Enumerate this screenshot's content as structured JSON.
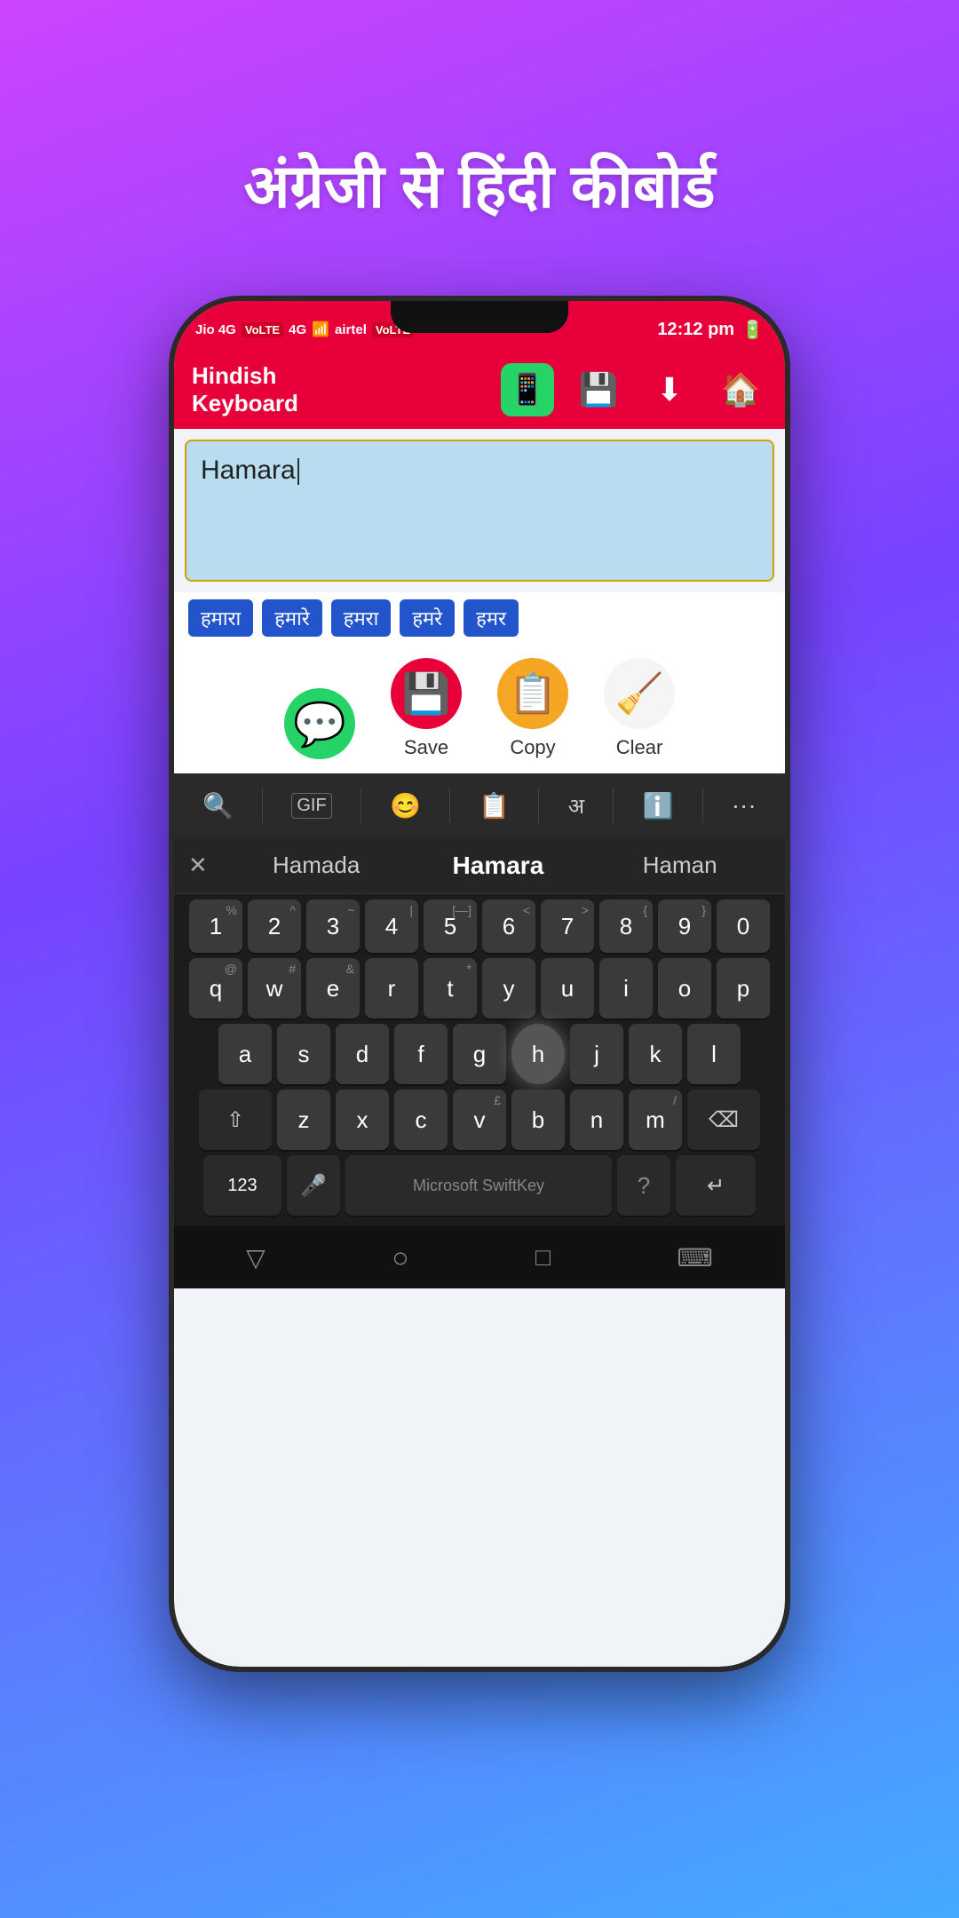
{
  "background": {
    "gradient_start": "#cc44ff",
    "gradient_end": "#44aaff"
  },
  "header": {
    "title": "अंग्रेजी से हिंदी कीबोर्ड"
  },
  "status_bar": {
    "carrier1": "Jio 4G",
    "carrier1_badge": "VoLTE",
    "carrier2": "4G",
    "carrier3": "airtel",
    "carrier3_badge": "VoLTE",
    "time": "12:12 pm",
    "battery": "🔋"
  },
  "app_header": {
    "title_line1": "Hindish",
    "title_line2": "Keyboard",
    "icons": [
      "whatsapp",
      "save",
      "download",
      "home"
    ]
  },
  "text_area": {
    "content": "Hamara",
    "placeholder": ""
  },
  "suggestions": [
    "हमारा",
    "हमारे",
    "हमरा",
    "हमरे",
    "हमर"
  ],
  "actions": [
    {
      "label": "Save",
      "icon": "💾",
      "bg": "red"
    },
    {
      "label": "Copy",
      "icon": "📋",
      "bg": "orange"
    },
    {
      "label": "Clear",
      "icon": "🧹",
      "bg": "white"
    }
  ],
  "keyboard": {
    "toolbar_icons": [
      "🔍",
      "GIF",
      "😊",
      "📋",
      "अ",
      "ℹ",
      "···"
    ],
    "autocomplete": [
      "Hamada",
      "Hamara",
      "Haman"
    ],
    "rows": {
      "numbers": [
        "1",
        "2",
        "3",
        "4",
        "5",
        "6",
        "7",
        "8",
        "9",
        "0"
      ],
      "number_subs": [
        "%",
        "^",
        "~",
        "|",
        "[—]",
        "<",
        ">",
        "{",
        "}",
        ""
      ],
      "row_q": [
        "q",
        "w",
        "e",
        "r",
        "t",
        "y",
        "u",
        "i",
        "o",
        "p"
      ],
      "row_q_subs": [
        "@",
        "#",
        "&",
        "",
        "*",
        "",
        "",
        "",
        "",
        ""
      ],
      "row_a": [
        "a",
        "s",
        "d",
        "f",
        "g",
        "h",
        "j",
        "k",
        "l"
      ],
      "row_a_subs": [
        "",
        "",
        "",
        "",
        "",
        "",
        "",
        "",
        ""
      ],
      "row_z": [
        "z",
        "x",
        "c",
        "v",
        "b",
        "n",
        "m"
      ],
      "row_z_subs": [
        "",
        "",
        "",
        "£",
        "",
        "",
        "/"
      ],
      "space_label": "Microsoft SwiftKey",
      "key_123": "123"
    }
  },
  "bottom_nav": [
    "▽",
    "○",
    "□",
    "⌨"
  ]
}
